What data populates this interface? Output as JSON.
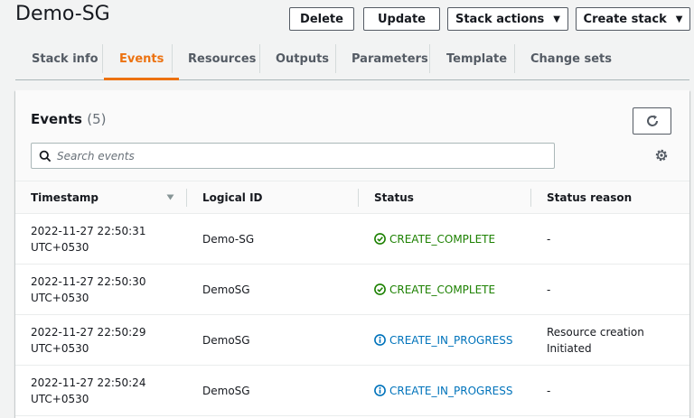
{
  "header": {
    "title": "Demo-SG",
    "buttons": {
      "delete": "Delete",
      "update": "Update",
      "stack_actions": "Stack actions",
      "create_stack": "Create stack"
    }
  },
  "tabs": [
    {
      "label": "Stack info",
      "active": false
    },
    {
      "label": "Events",
      "active": true
    },
    {
      "label": "Resources",
      "active": false
    },
    {
      "label": "Outputs",
      "active": false
    },
    {
      "label": "Parameters",
      "active": false
    },
    {
      "label": "Template",
      "active": false
    },
    {
      "label": "Change sets",
      "active": false
    }
  ],
  "events": {
    "title": "Events",
    "count": "(5)",
    "search_placeholder": "Search events",
    "columns": {
      "timestamp": "Timestamp",
      "logical_id": "Logical ID",
      "status": "Status",
      "status_reason": "Status reason"
    },
    "rows": [
      {
        "date": "2022-11-27 22:50:31",
        "tz": "UTC+0530",
        "logical_id": "Demo-SG",
        "status": "CREATE_COMPLETE",
        "reason_line1": "-",
        "reason_line2": ""
      },
      {
        "date": "2022-11-27 22:50:30",
        "tz": "UTC+0530",
        "logical_id": "DemoSG",
        "status": "CREATE_COMPLETE",
        "reason_line1": "-",
        "reason_line2": ""
      },
      {
        "date": "2022-11-27 22:50:29",
        "tz": "UTC+0530",
        "logical_id": "DemoSG",
        "status": "CREATE_IN_PROGRESS",
        "reason_line1": "Resource creation",
        "reason_line2": "Initiated"
      },
      {
        "date": "2022-11-27 22:50:24",
        "tz": "UTC+0530",
        "logical_id": "DemoSG",
        "status": "CREATE_IN_PROGRESS",
        "reason_line1": "-",
        "reason_line2": ""
      }
    ]
  },
  "colors": {
    "accent": "#ec7211",
    "success": "#1d8102",
    "info": "#0073bb",
    "background": "#f2f3f3"
  },
  "icons": {
    "complete": "check-circle-icon",
    "in_progress": "info-circle-icon",
    "refresh": "refresh-icon",
    "search": "search-icon",
    "settings": "gear-icon",
    "sort": "sort-down-icon",
    "dropdown": "caret-down-icon"
  }
}
